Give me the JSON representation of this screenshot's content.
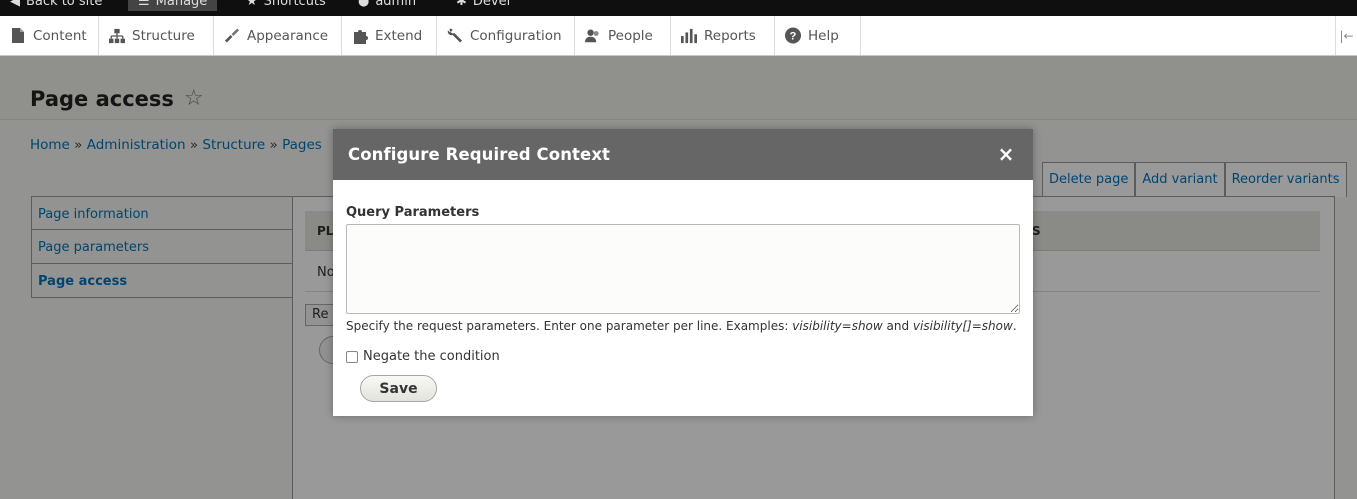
{
  "toolbar": {
    "top_items": [
      {
        "label": "Back to site",
        "icon": "back-icon"
      },
      {
        "label": "Manage",
        "icon": "menu-icon"
      },
      {
        "label": "Shortcuts",
        "icon": "star-icon"
      },
      {
        "label": "admin",
        "icon": "user-icon"
      },
      {
        "label": "Devel",
        "icon": "gear-icon"
      }
    ],
    "tray_items": [
      {
        "label": "Content",
        "icon": "file-icon"
      },
      {
        "label": "Structure",
        "icon": "sitemap-icon"
      },
      {
        "label": "Appearance",
        "icon": "paintbrush-icon"
      },
      {
        "label": "Extend",
        "icon": "puzzle-icon"
      },
      {
        "label": "Configuration",
        "icon": "wrench-icon"
      },
      {
        "label": "People",
        "icon": "people-icon"
      },
      {
        "label": "Reports",
        "icon": "bar-chart-icon"
      },
      {
        "label": "Help",
        "icon": "help-icon"
      }
    ]
  },
  "page": {
    "title": "Page access",
    "breadcrumb": [
      "Home",
      "Administration",
      "Structure",
      "Pages"
    ],
    "breadcrumb_sep": "»",
    "side_tabs": [
      "Page information",
      "Page parameters",
      "Page access"
    ],
    "action_tabs": [
      "Delete page",
      "Add variant",
      "Reorder variants"
    ],
    "table_header_fragment": "PL",
    "table_header_fragment_right": "S",
    "table_row_fragment": "No",
    "select_fragment": "Re"
  },
  "dialog": {
    "title": "Configure Required Context",
    "close_glyph": "×",
    "field_label": "Query Parameters",
    "field_value": "",
    "desc_prefix": "Specify the request parameters. Enter one parameter per line. Examples: ",
    "desc_example1": "visibility=show",
    "desc_mid": " and ",
    "desc_example2": "visibility[]=show",
    "desc_suffix": ".",
    "checkbox_label": "Negate the condition",
    "checkbox_checked": false,
    "save_label": "Save"
  },
  "colors": {
    "link": "#0074bd",
    "dialog_titlebar": "#666666",
    "toolbar_dark": "#0f0f0f"
  }
}
